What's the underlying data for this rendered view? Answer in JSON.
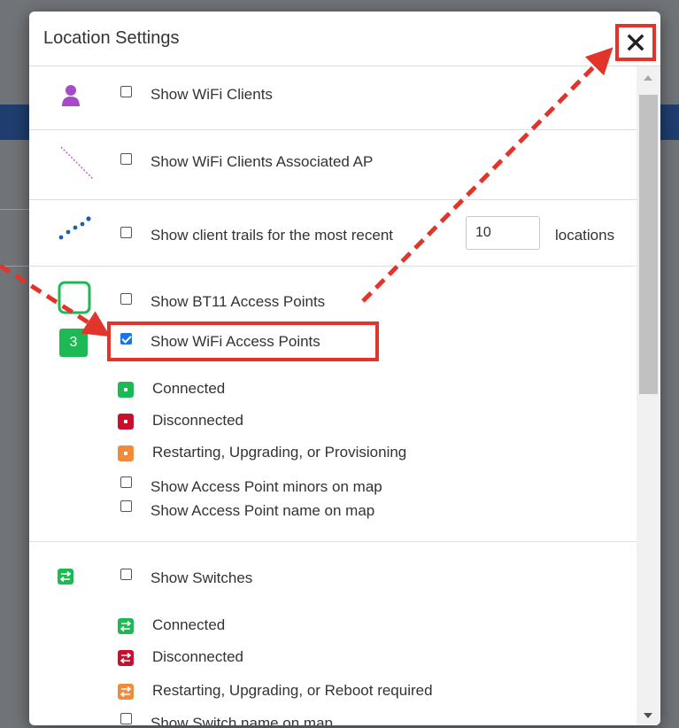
{
  "dialog": {
    "title": "Location Settings",
    "close_icon": "close-icon"
  },
  "sections": {
    "wifi_clients": {
      "label": "Show WiFi Clients",
      "checked": false,
      "icon": "person-icon"
    },
    "wifi_clients_ap": {
      "label": "Show WiFi Clients Associated AP",
      "checked": false,
      "icon": "dotted-line-icon"
    },
    "client_trails": {
      "label": "Show client trails for the most recent",
      "value": "10",
      "suffix": "locations",
      "checked": false,
      "icon": "trail-dots-icon"
    },
    "bt11_ap": {
      "label": "Show BT11 Access Points",
      "checked": false,
      "icon": "square-outline-icon"
    },
    "wifi_ap": {
      "label": "Show WiFi Access Points",
      "checked": true,
      "badge": "3",
      "legend": [
        {
          "label": "Connected",
          "color": "#1db954"
        },
        {
          "label": "Disconnected",
          "color": "#c8102e"
        },
        {
          "label": "Restarting, Upgrading, or Provisioning",
          "color": "#f08a3c"
        }
      ],
      "minors_label": "Show Access Point minors on map",
      "name_label": "Show Access Point name on map"
    },
    "switches": {
      "label": "Show Switches",
      "checked": false,
      "icon": "switch-icon",
      "legend": [
        {
          "label": "Connected",
          "color": "#1db954"
        },
        {
          "label": "Disconnected",
          "color": "#c8102e"
        },
        {
          "label": "Restarting, Upgrading, or Reboot required",
          "color": "#f08a3c"
        }
      ],
      "name_label": "Show Switch name on map"
    }
  },
  "colors": {
    "accent_red": "#e2342b",
    "checkbox_blue": "#1a73e8",
    "purple": "#a64ac9",
    "green": "#1db954",
    "trail_blue": "#1f5fae"
  }
}
